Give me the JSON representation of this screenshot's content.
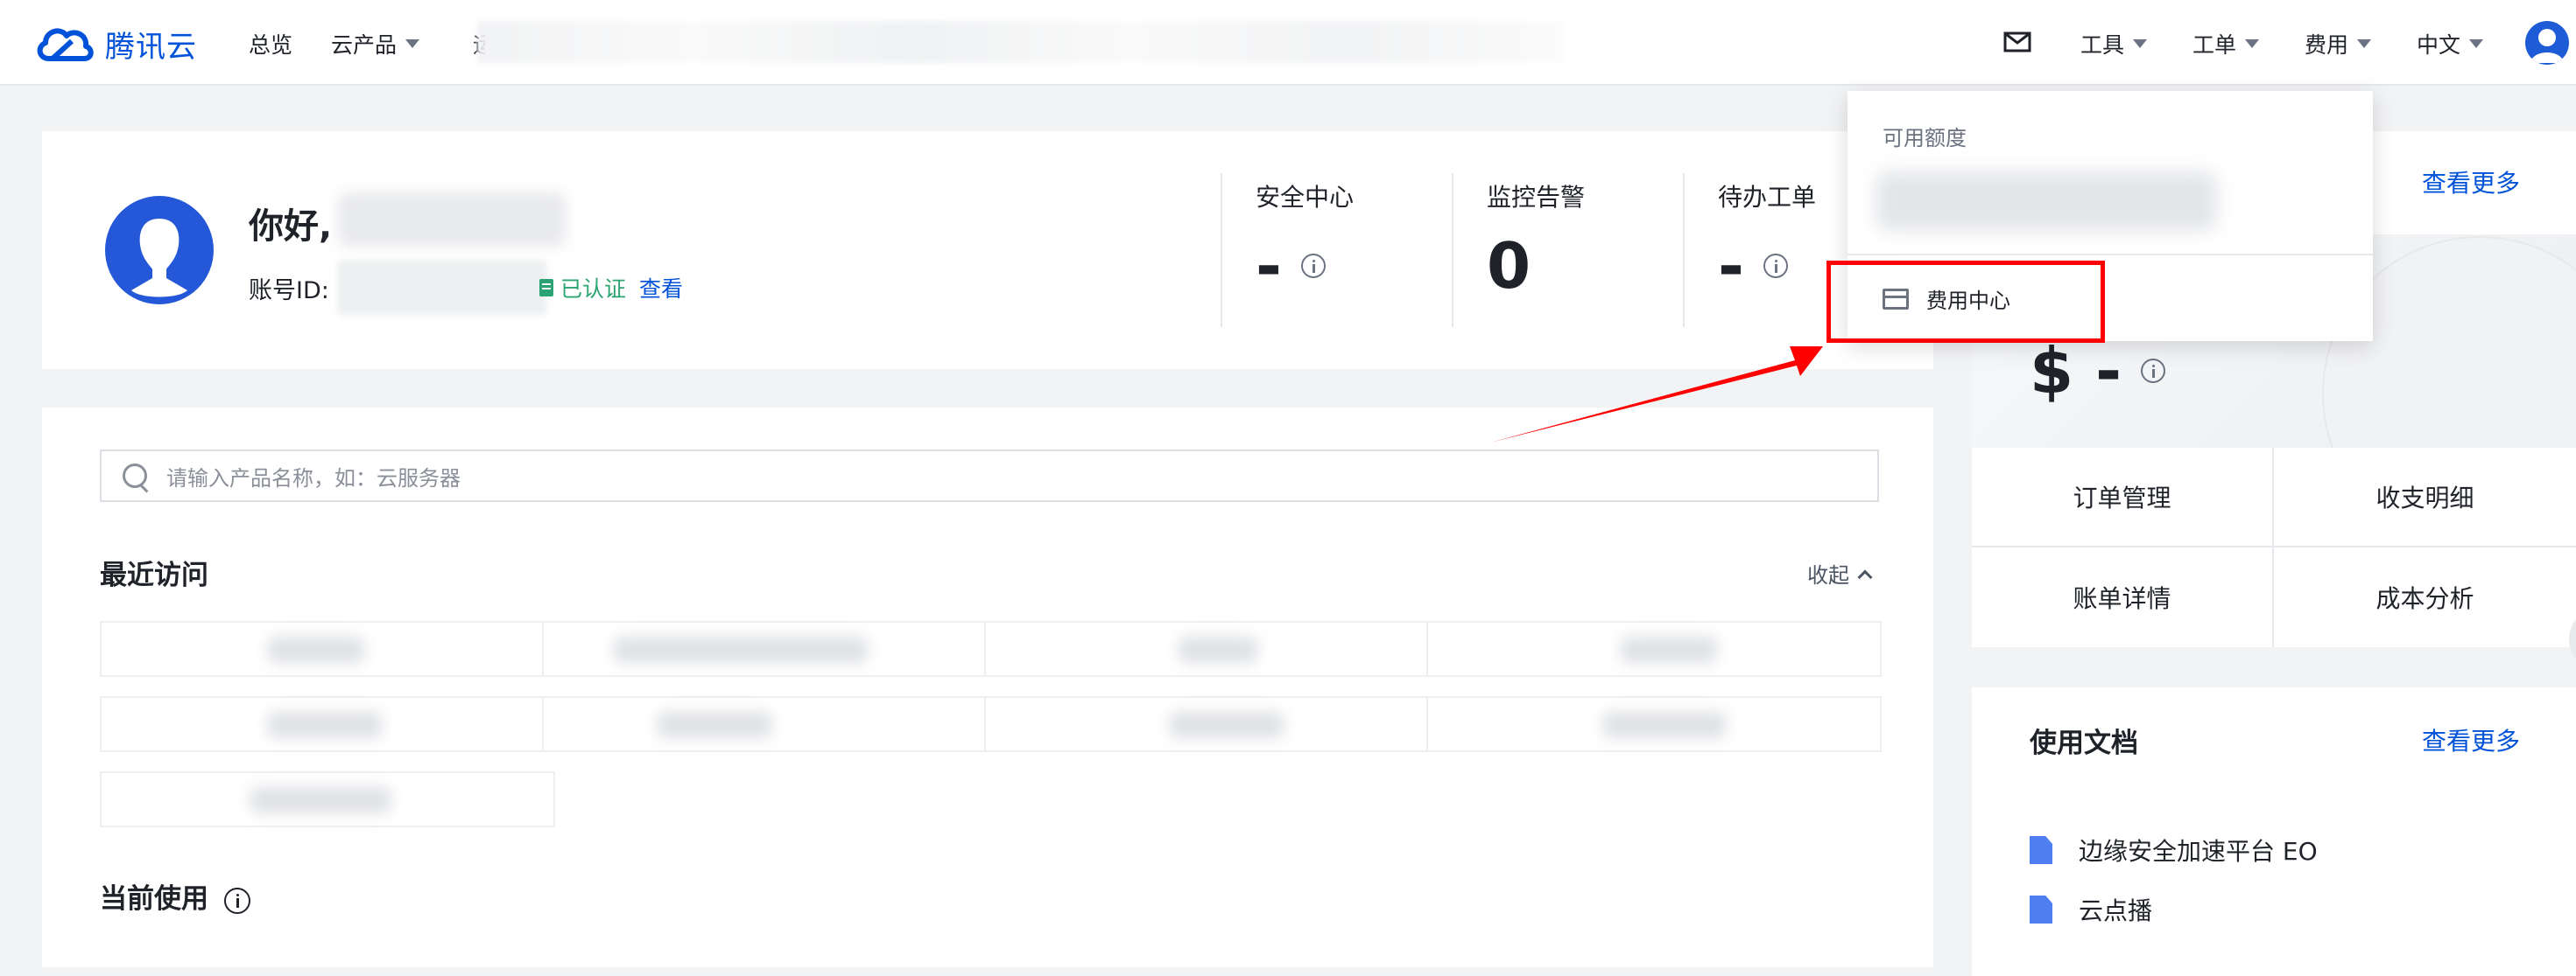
{
  "header": {
    "logo_text": "腾讯云",
    "nav": [
      "总览",
      "云产品"
    ],
    "nav_partial": "运",
    "right": {
      "tools": "工具",
      "tickets": "工单",
      "billing": "费用",
      "language": "中文"
    }
  },
  "profile": {
    "greeting": "你好,",
    "account_id_label": "账号ID:",
    "verified_label": "已认证",
    "view_label": "查看",
    "stats": [
      {
        "title": "安全中心",
        "value": "-"
      },
      {
        "title": "监控告警",
        "value": "0"
      },
      {
        "title": "待办工单",
        "value": "-"
      }
    ]
  },
  "main": {
    "search_placeholder": "请输入产品名称，如：云服务器",
    "recent_title": "最近访问",
    "collapse_label": "收起",
    "current_title": "当前使用"
  },
  "fee": {
    "more_label": "查看更多",
    "amount": "$ -",
    "actions": [
      "订单管理",
      "收支明细",
      "账单详情",
      "成本分析"
    ]
  },
  "docs": {
    "title": "使用文档",
    "more_label": "查看更多",
    "items": [
      "边缘安全加速平台 EO",
      "云点播"
    ]
  },
  "dropdown": {
    "available_label": "可用额度",
    "billing_center": "费用中心"
  },
  "colors": {
    "brand": "#0052d9",
    "verified": "#2ba471",
    "highlight": "#ff0000"
  }
}
